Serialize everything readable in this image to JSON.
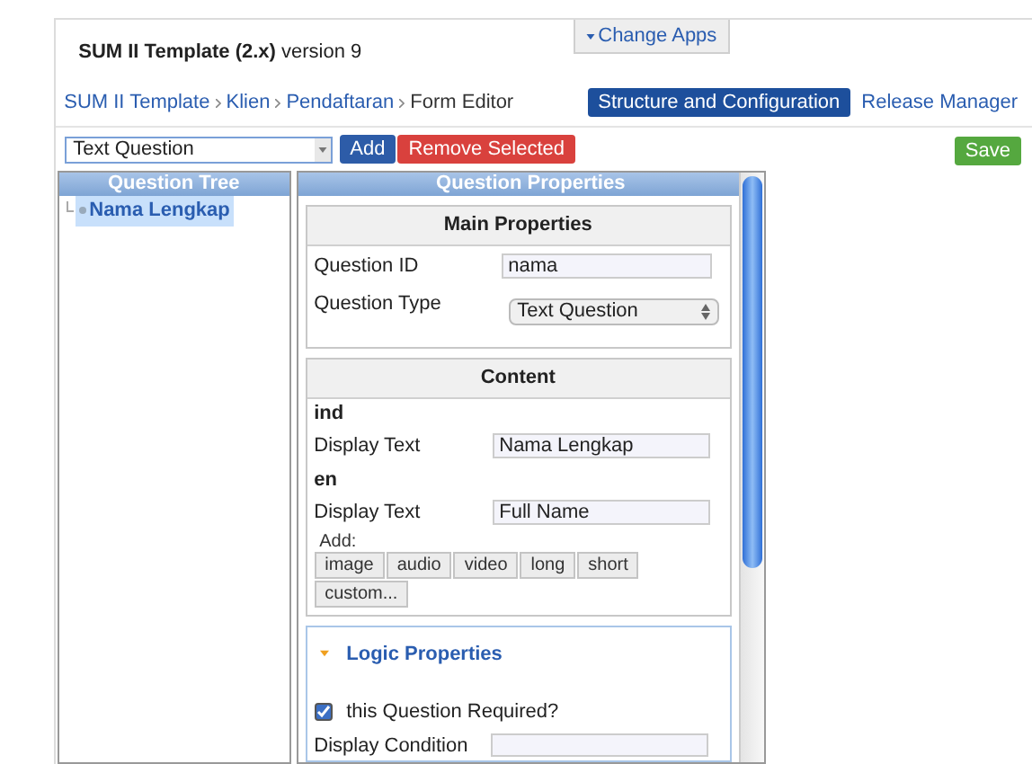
{
  "header": {
    "title": "SUM II Template (2.x)",
    "version": "version 9",
    "change_apps": "Change Apps"
  },
  "breadcrumbs": [
    {
      "label": "SUM II Template",
      "link": true
    },
    {
      "label": "Klien",
      "link": true
    },
    {
      "label": "Pendaftaran",
      "link": true
    },
    {
      "label": "Form Editor",
      "link": false
    }
  ],
  "nav": [
    {
      "label": "Structure and Configuration",
      "selected": true
    },
    {
      "label": "Release Manager",
      "selected": false
    }
  ],
  "toolbar": {
    "question_type": "Text Question",
    "add": "Add",
    "remove": "Remove Selected",
    "save": "Save"
  },
  "question_tree": {
    "title": "Question Tree",
    "items": [
      {
        "label": "Nama Lengkap",
        "selected": true
      }
    ]
  },
  "properties": {
    "title": "Question Properties",
    "main": {
      "title": "Main Properties",
      "question_id_label": "Question ID",
      "question_id": "nama",
      "question_type_label": "Question Type",
      "question_type": "Text Question"
    },
    "content": {
      "title": "Content",
      "languages": [
        {
          "code": "ind",
          "label": "Display Text",
          "value": "Nama Lengkap"
        },
        {
          "code": "en",
          "label": "Display Text",
          "value": "Full Name"
        }
      ],
      "add_label": "Add:",
      "add_buttons": [
        "image",
        "audio",
        "video",
        "long",
        "short",
        "custom..."
      ]
    },
    "logic": {
      "title": "Logic Properties",
      "expanded": true,
      "required_label": "this Question Required?",
      "required": true,
      "display_condition_label": "Display Condition"
    }
  }
}
